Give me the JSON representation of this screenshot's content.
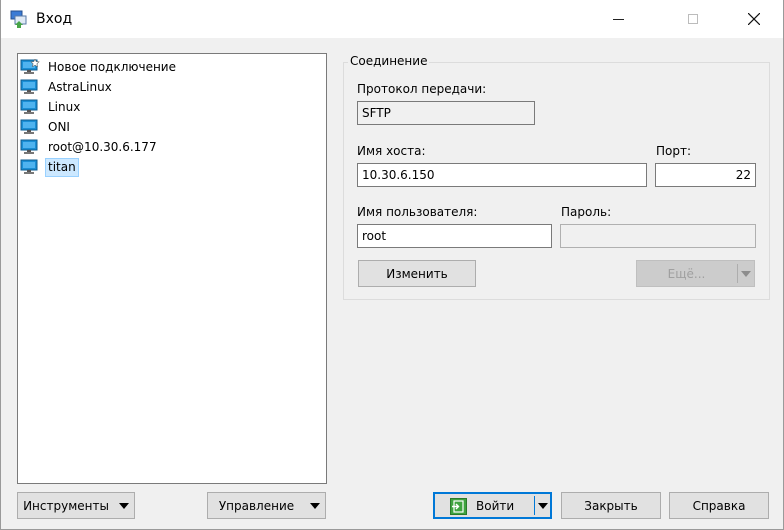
{
  "window": {
    "title": "Вход"
  },
  "sites": [
    {
      "label": "Новое подключение",
      "icon": "new-site-icon"
    },
    {
      "label": "AstraLinux",
      "icon": "monitor-icon"
    },
    {
      "label": "Linux",
      "icon": "monitor-icon"
    },
    {
      "label": "ONI",
      "icon": "monitor-icon"
    },
    {
      "label": "root@10.30.6.177",
      "icon": "monitor-icon"
    },
    {
      "label": "titan",
      "icon": "monitor-icon",
      "selected": true
    }
  ],
  "session": {
    "group_title": "Соединение",
    "protocol_label": "Протокол передачи:",
    "protocol_value": "SFTP",
    "host_label": "Имя хоста:",
    "host_value": "10.30.6.150",
    "port_label": "Порт:",
    "port_value": "22",
    "user_label": "Имя пользователя:",
    "user_value": "root",
    "password_label": "Пароль:",
    "password_value": "",
    "edit_button": "Изменить",
    "more_button": "Ещё..."
  },
  "footer": {
    "tools_button": "Инструменты",
    "manage_button": "Управление",
    "login_button": "Войти",
    "close_button": "Закрыть",
    "help_button": "Справка"
  },
  "colors": {
    "selection": "#cce8ff",
    "accent": "#0078d7",
    "monitor": "#1a8fd6"
  }
}
